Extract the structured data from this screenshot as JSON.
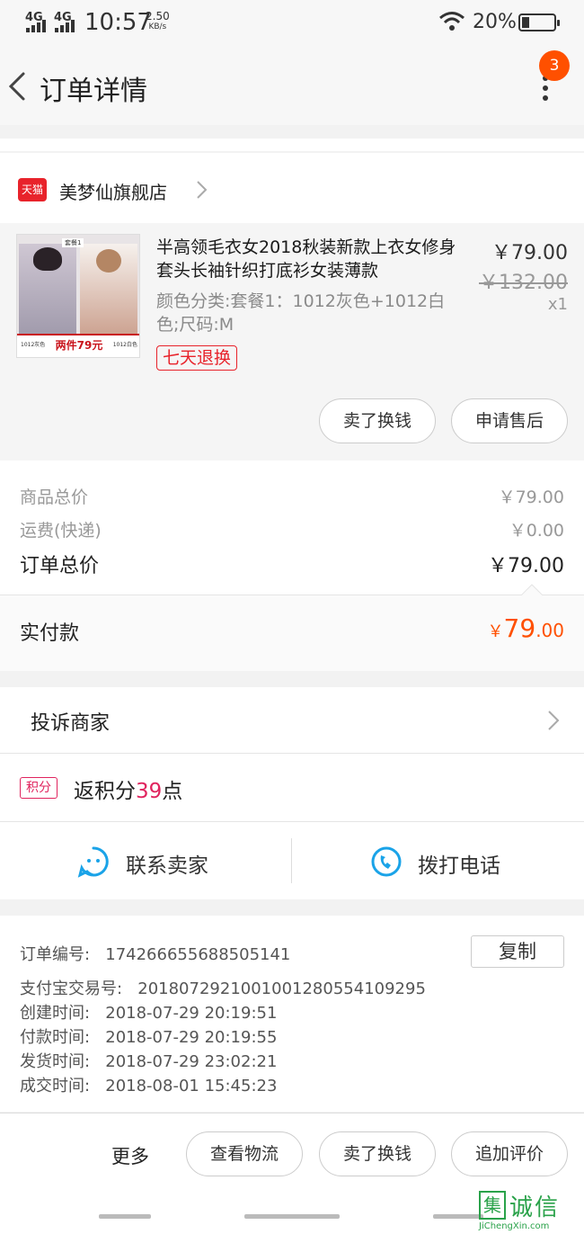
{
  "status_bar": {
    "network1": "4G",
    "network2": "4G",
    "time": "10:57",
    "speed": "2.50",
    "speed_unit": "KB/s",
    "battery": "20%"
  },
  "header": {
    "title": "订单详情",
    "badge_count": "3"
  },
  "shop": {
    "badge": "天猫",
    "name": "美梦仙旗舰店"
  },
  "product": {
    "image_tag": "套餐1",
    "image_banner": "两件79元",
    "image_banner_left": "1012灰色",
    "image_banner_right": "1012白色",
    "title": "半高领毛衣女2018秋装新款上衣女修身套头长袖针织打底衫女装薄款",
    "spec": "颜色分类:套餐1：1012灰色+1012白色;尺码:M",
    "return_tag": "七天退换",
    "price": "￥79.00",
    "original_price": "￥132.00",
    "quantity": "x1",
    "btn_exchange": "卖了换钱",
    "btn_after_sale": "申请售后"
  },
  "summary": {
    "goods_label": "商品总价",
    "goods_value": "￥79.00",
    "shipping_label": "运费(快递)",
    "shipping_value": "￥0.00",
    "total_label": "订单总价",
    "total_value": "￥79.00",
    "paid_label": "实付款",
    "paid_currency": "￥",
    "paid_int": "79",
    "paid_dec": ".00"
  },
  "complaint": {
    "label": "投诉商家"
  },
  "points": {
    "badge": "积分",
    "prefix": "返积分",
    "value": "39",
    "suffix": "点"
  },
  "contact": {
    "seller": "联系卖家",
    "phone": "拨打电话"
  },
  "order_info": {
    "order_no_label": "订单编号:",
    "order_no": "174266655688505141",
    "copy_label": "复制",
    "alipay_label": "支付宝交易号:",
    "alipay_no": "2018072921001001280554109295",
    "created_label": "创建时间:",
    "created": "2018-07-29 20:19:51",
    "paid_label": "付款时间:",
    "paid": "2018-07-29 20:19:55",
    "shipped_label": "发货时间:",
    "shipped": "2018-07-29 23:02:21",
    "closed_label": "成交时间:",
    "closed": "2018-08-01 15:45:23"
  },
  "bottom_bar": {
    "more": "更多",
    "logistics": "查看物流",
    "exchange": "卖了换钱",
    "add_review": "追加评价"
  },
  "watermark": {
    "char": "集",
    "text": "诚信",
    "url": "JiChengXin.com"
  },
  "colors": {
    "accent": "#ff5000",
    "tmall_red": "#e8232b",
    "points_pink": "#e0245e",
    "icon_blue": "#1aa3e8"
  }
}
